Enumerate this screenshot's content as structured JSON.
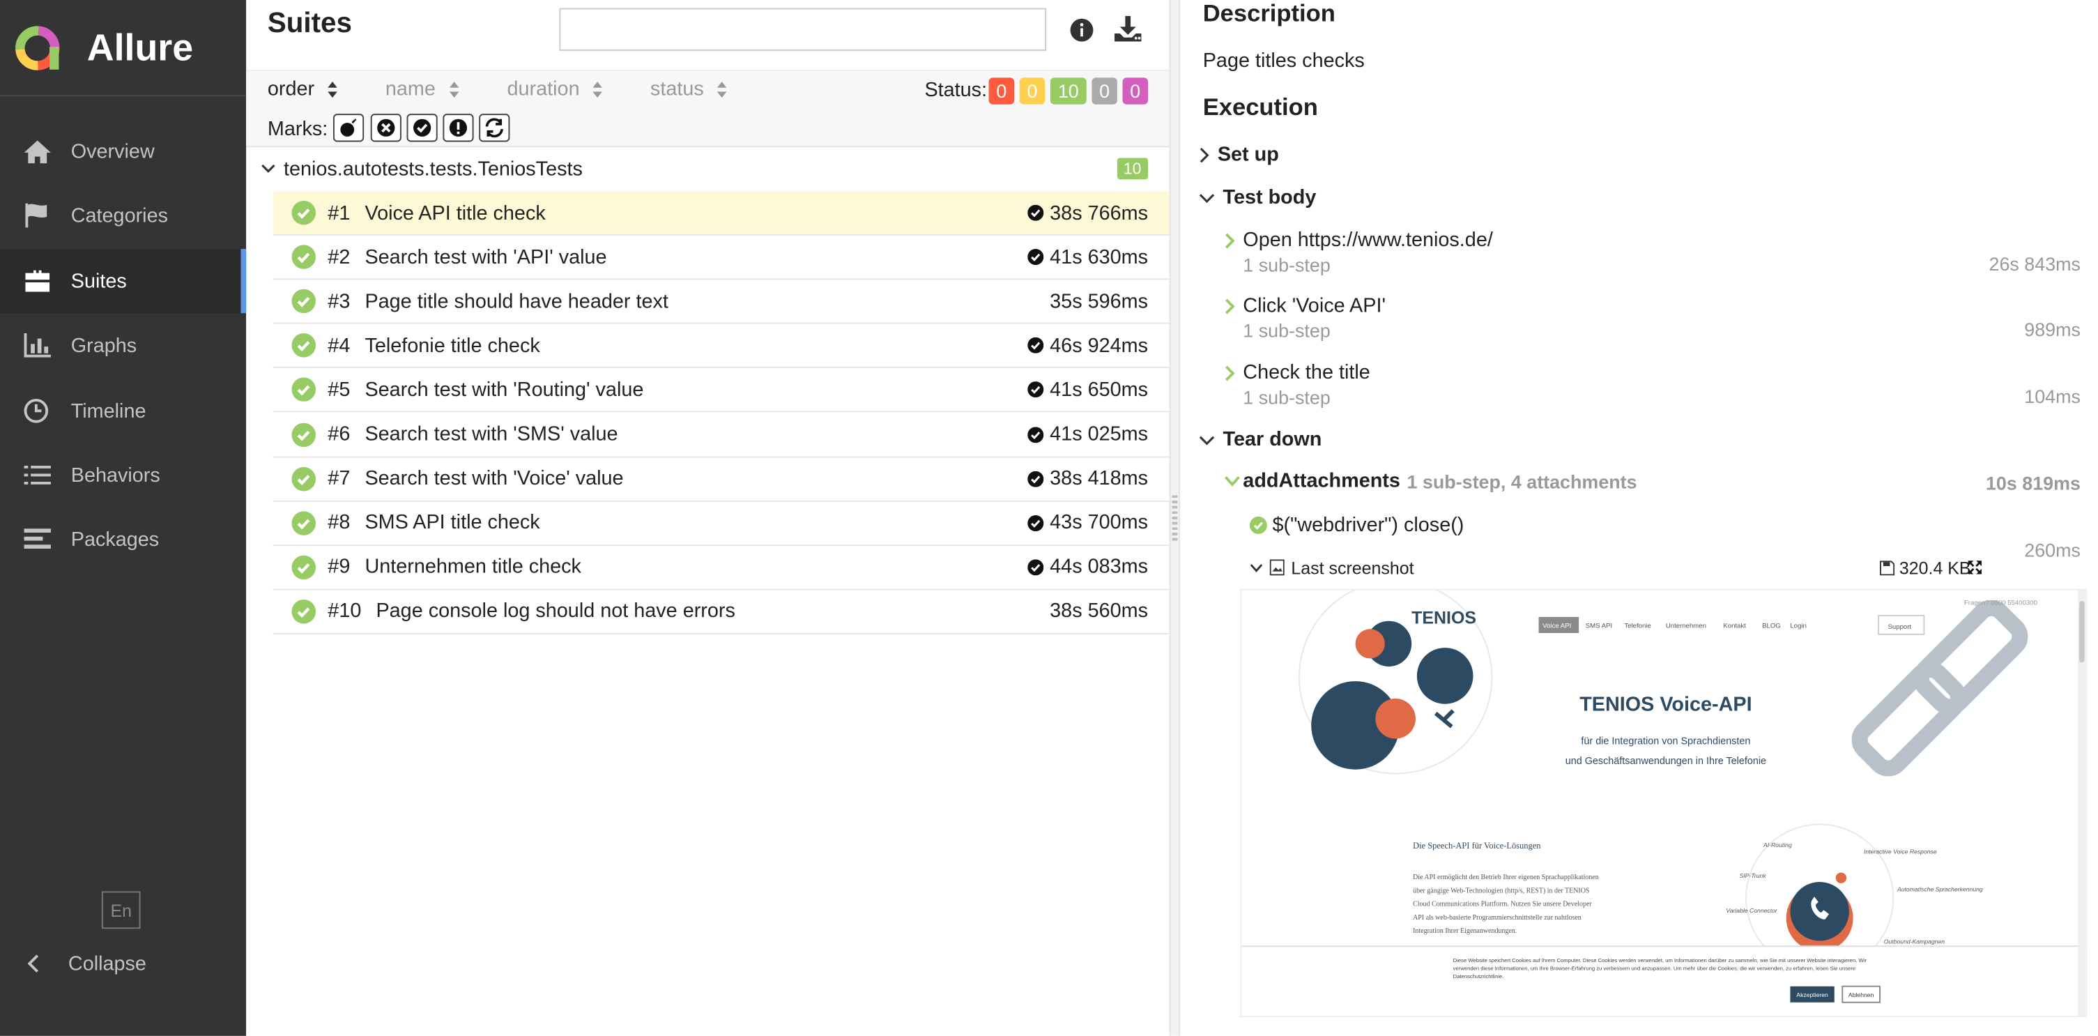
{
  "brand": {
    "title": "Allure"
  },
  "nav": [
    {
      "label": "Overview",
      "icon": "home-icon"
    },
    {
      "label": "Categories",
      "icon": "flag-icon"
    },
    {
      "label": "Suites",
      "icon": "briefcase-icon",
      "active": true
    },
    {
      "label": "Graphs",
      "icon": "bar-chart-icon"
    },
    {
      "label": "Timeline",
      "icon": "clock-icon"
    },
    {
      "label": "Behaviors",
      "icon": "list-icon"
    },
    {
      "label": "Packages",
      "icon": "align-left-icon"
    }
  ],
  "footer": {
    "lang": "En",
    "collapse": "Collapse"
  },
  "suites": {
    "title": "Suites",
    "sort": {
      "order": "order",
      "name": "name",
      "duration": "duration",
      "status": "status"
    },
    "status_label": "Status:",
    "status_counts": [
      {
        "value": "0",
        "color": "#fd5a3e"
      },
      {
        "value": "0",
        "color": "#ffd050"
      },
      {
        "value": "10",
        "color": "#97cc64"
      },
      {
        "value": "0",
        "color": "#aaaaaa"
      },
      {
        "value": "0",
        "color": "#d35ebe"
      }
    ],
    "marks_label": "Marks:",
    "group": {
      "name": "tenios.autotests.tests.TeniosTests",
      "count": "10"
    },
    "rows": [
      {
        "num": "#1",
        "name": "Voice API title check",
        "duration": "38s 766ms",
        "flag": true
      },
      {
        "num": "#2",
        "name": "Search test with 'API' value",
        "duration": "41s 630ms",
        "flag": true
      },
      {
        "num": "#3",
        "name": "Page title should have header text",
        "duration": "35s 596ms",
        "flag": false
      },
      {
        "num": "#4",
        "name": "Telefonie title check",
        "duration": "46s 924ms",
        "flag": true
      },
      {
        "num": "#5",
        "name": "Search test with 'Routing' value",
        "duration": "41s 650ms",
        "flag": true
      },
      {
        "num": "#6",
        "name": "Search test with 'SMS' value",
        "duration": "41s 025ms",
        "flag": true
      },
      {
        "num": "#7",
        "name": "Search test with 'Voice' value",
        "duration": "38s 418ms",
        "flag": true
      },
      {
        "num": "#8",
        "name": "SMS API title check",
        "duration": "43s 700ms",
        "flag": true
      },
      {
        "num": "#9",
        "name": "Unternehmen title check",
        "duration": "44s 083ms",
        "flag": true
      },
      {
        "num": "#10",
        "name": "Page console log should not have errors",
        "duration": "38s 560ms",
        "flag": false
      }
    ]
  },
  "detail": {
    "description_title": "Description",
    "description": "Page titles checks",
    "execution_title": "Execution",
    "setup": "Set up",
    "test_body": "Test body",
    "steps": [
      {
        "name": "Open https://www.tenios.de/",
        "sub": "1 sub-step",
        "time": "26s 843ms"
      },
      {
        "name": "Click 'Voice API'",
        "sub": "1 sub-step",
        "time": "989ms"
      },
      {
        "name": "Check the title",
        "sub": "1 sub-step",
        "time": "104ms"
      }
    ],
    "teardown": "Tear down",
    "add_attachments": {
      "name": "addAttachments",
      "meta": "1 sub-step, 4 attachments",
      "time": "10s 819ms"
    },
    "close_step": {
      "name": "$(\"webdriver\") close()",
      "time": "260ms"
    },
    "attachment": {
      "name": "Last screenshot",
      "size": "320.4 KB"
    }
  },
  "screenshot": {
    "logo": "TENIOS",
    "phone": "Fragen? 0800 55400300",
    "nav": [
      "Voice API",
      "SMS API",
      "Telefonie",
      "Unternehmen",
      "Kontakt",
      "BLOG",
      "Login"
    ],
    "support": "Support",
    "hero_title": "TENIOS Voice-API",
    "hero_sub1": "für die Integration von Sprachdiensten",
    "hero_sub2": "und Geschäftsanwendungen in Ihre Telefonie",
    "section_title": "Die Speech-API für Voice-Lösungen",
    "section_text": [
      "Die API ermöglicht den Betrieb Ihrer eigenen Sprachapplikationen",
      "über gängige Web-Technologien (http/s, REST) in der TENIOS",
      "Cloud Communications Plattform. Nutzen Sie unsere Developer",
      "API als web-basierte Programmierschnittstelle zur nahtlosen",
      "Integration Ihrer Eigenanwendungen."
    ],
    "diagram_labels": [
      "AI-Routing",
      "Interactive Voice Response",
      "SIP-Trunk",
      "Automatische Spracherkennung",
      "Variable Connector",
      "Outbound-Kampagnen"
    ],
    "cookie_text": [
      "Diese Website speichert Cookies auf Ihrem Computer. Diese Cookies werden verwendet, um Informationen darüber zu sammeln, wie Sie mit unserer Website interagieren. Wir",
      "verwenden diese Informationen, um Ihre Browser-Erfahrung zu verbessern und anzupassen. Um mehr über die Cookies, die wir verwenden, zu erfahren, lesen Sie unsere",
      "Datenschutzrichtlinie."
    ],
    "accept": "Akzeptieren",
    "decline": "Ablehnen"
  }
}
